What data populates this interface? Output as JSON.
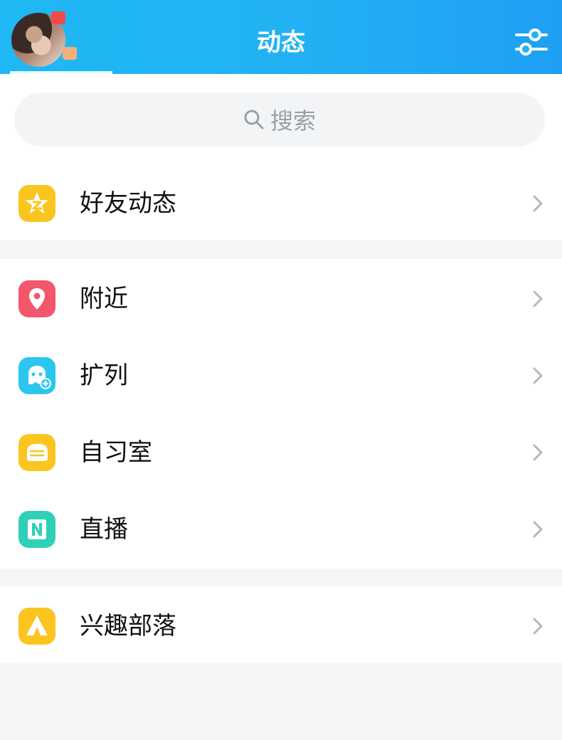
{
  "header": {
    "title": "动态",
    "avatar_icon": "avatar",
    "filter_icon": "sliders-icon",
    "colors": {
      "gradient_start": "#1fb8f4",
      "gradient_end": "#1e9ff3"
    }
  },
  "search": {
    "placeholder": "搜索",
    "icon": "search-icon"
  },
  "groups": [
    {
      "items": [
        {
          "label": "好友动态",
          "icon": "qzone-star-icon",
          "color": "#fbc51f"
        }
      ]
    },
    {
      "items": [
        {
          "label": "附近",
          "icon": "location-pin-icon",
          "color": "#f2576c"
        },
        {
          "label": "扩列",
          "icon": "add-friend-ghost-icon",
          "color": "#2bc6f0"
        },
        {
          "label": "自习室",
          "icon": "study-room-icon",
          "color": "#fbc51f"
        },
        {
          "label": "直播",
          "icon": "live-icon",
          "color": "#2ed0b8"
        }
      ]
    },
    {
      "items": [
        {
          "label": "兴趣部落",
          "icon": "tent-icon",
          "color": "#fbc51f"
        }
      ]
    }
  ]
}
